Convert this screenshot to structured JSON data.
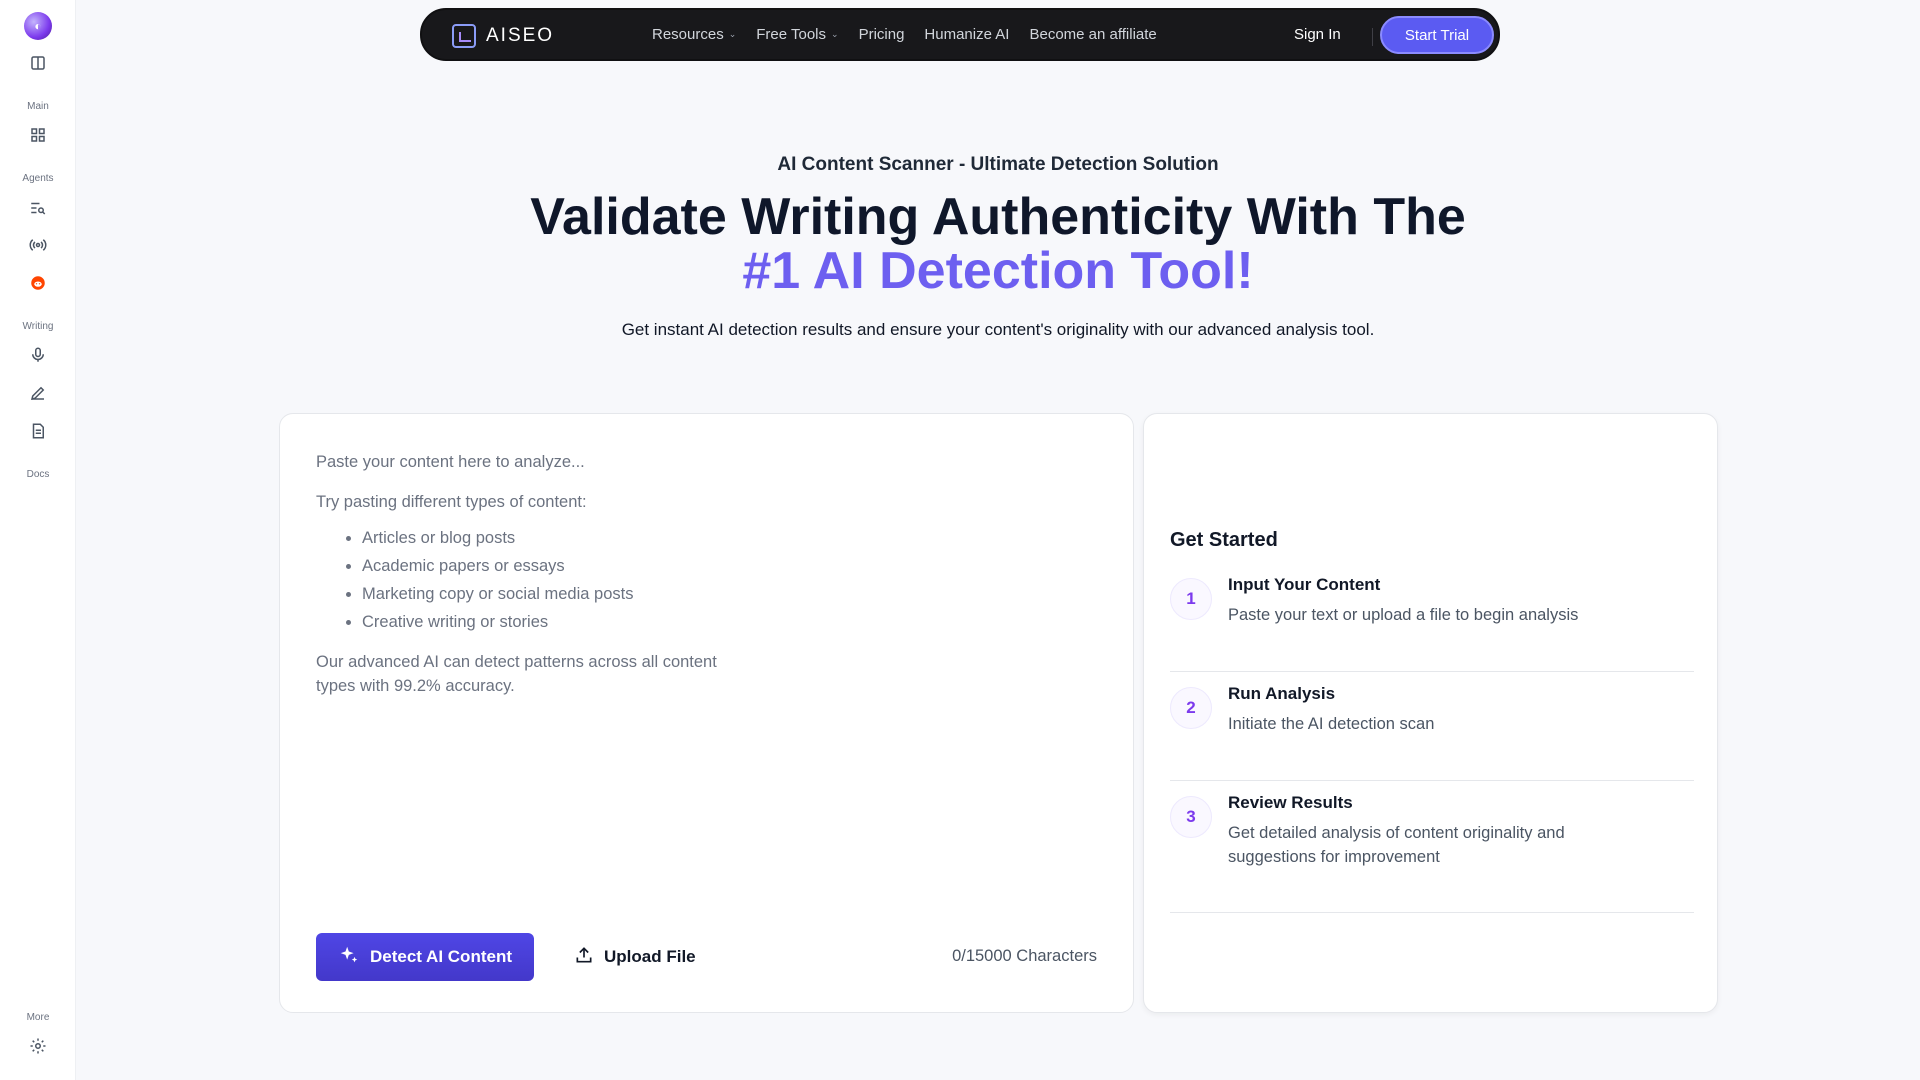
{
  "sidebar": {
    "sections": {
      "main": "Main",
      "agents": "Agents",
      "writing": "Writing",
      "docs": "Docs",
      "more": "More"
    },
    "icons": [
      "panel-toggle-icon",
      "grid-icon",
      "search-list-icon",
      "broadcast-icon",
      "reddit-icon",
      "microphone-icon",
      "pen-icon",
      "document-icon",
      "settings-icon"
    ]
  },
  "nav": {
    "brand": "AISEO",
    "links": [
      "Resources",
      "Free Tools",
      "Pricing",
      "Humanize AI",
      "Become an affiliate"
    ],
    "signin": "Sign In",
    "cta": "Start Trial"
  },
  "hero": {
    "eyebrow": "AI Content Scanner - Ultimate Detection Solution",
    "title_line1": "Validate Writing Authenticity With The",
    "title_line2": "#1 AI Detection Tool!",
    "subtitle": "Get instant AI detection results and ensure your content's originality with our advanced analysis tool."
  },
  "editor": {
    "placeholder_intro": "Paste your content here to analyze...",
    "placeholder_try": "Try pasting different types of content:",
    "examples": [
      "Articles or blog posts",
      "Academic papers or essays",
      "Marketing copy or social media posts",
      "Creative writing or stories"
    ],
    "placeholder_outro": "Our advanced AI can detect patterns across all content types with 99.2% accuracy.",
    "detect_label": "Detect AI Content",
    "upload_label": "Upload File",
    "char_count": "0/15000 Characters"
  },
  "get_started": {
    "title": "Get Started",
    "steps": [
      {
        "num": "1",
        "title": "Input Your Content",
        "desc": "Paste your text or upload a file to begin analysis"
      },
      {
        "num": "2",
        "title": "Run Analysis",
        "desc": "Initiate the AI detection scan"
      },
      {
        "num": "3",
        "title": "Review Results",
        "desc": "Get detailed analysis of content originality and suggestions for improvement"
      }
    ]
  },
  "colors": {
    "accent": "#6d5ff0",
    "button": "#4338ca",
    "nav_bg": "#18181b"
  }
}
